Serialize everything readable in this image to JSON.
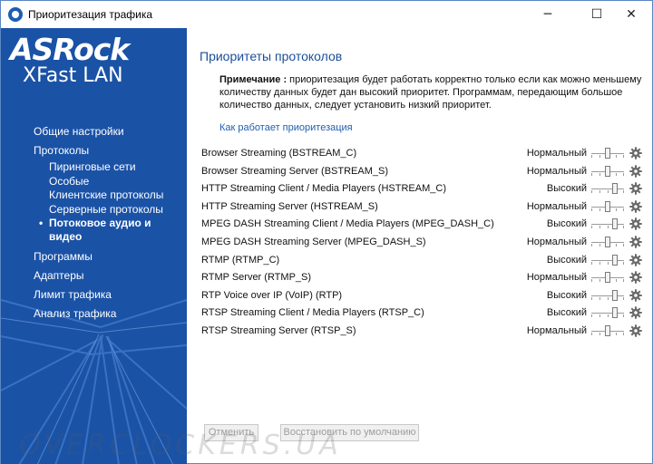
{
  "window": {
    "title": "Приоритезация трафика",
    "controls": {
      "minimize": "─",
      "maximize": "☐",
      "close": "✕"
    }
  },
  "sidebar": {
    "logo_brand": "ASRock",
    "logo_product": "XFast LAN",
    "nav": [
      {
        "label": "Общие настройки",
        "level": 0
      },
      {
        "label": "Протоколы",
        "level": 0
      },
      {
        "label": "Пиринговые сети",
        "level": 1
      },
      {
        "label": "Особые",
        "level": 1
      },
      {
        "label": "Клиентские протоколы",
        "level": 1
      },
      {
        "label": "Серверные протоколы",
        "level": 1
      },
      {
        "label": "Потоковое аудио и видео",
        "level": 1,
        "active": true
      },
      {
        "label": "Программы",
        "level": 0
      },
      {
        "label": "Адаптеры",
        "level": 0
      },
      {
        "label": "Лимит трафика",
        "level": 0
      },
      {
        "label": "Анализ трафика",
        "level": 0
      }
    ],
    "active_bullet": "•"
  },
  "main": {
    "title": "Приоритеты протоколов",
    "note_label": "Примечание :",
    "note_text": " приоритезация будет работать корректно только если как можно меньшему количеству данных будет дан высокий приоритет. Программам, передающим большое количество данных, следует установить низкий приоритет.",
    "help_link": "Как работает приоритезация",
    "protocols": [
      {
        "name": "Browser Streaming (BSTREAM_C)",
        "priority": "Нормальный",
        "level": 0.5
      },
      {
        "name": "Browser Streaming Server (BSTREAM_S)",
        "priority": "Нормальный",
        "level": 0.5
      },
      {
        "name": "HTTP Streaming Client / Media Players (HSTREAM_C)",
        "priority": "Высокий",
        "level": 0.75
      },
      {
        "name": "HTTP Streaming Server (HSTREAM_S)",
        "priority": "Нормальный",
        "level": 0.5
      },
      {
        "name": "MPEG DASH Streaming Client / Media Players (MPEG_DASH_C)",
        "priority": "Высокий",
        "level": 0.75
      },
      {
        "name": "MPEG DASH Streaming Server (MPEG_DASH_S)",
        "priority": "Нормальный",
        "level": 0.5
      },
      {
        "name": "RTMP (RTMP_C)",
        "priority": "Высокий",
        "level": 0.75
      },
      {
        "name": "RTMP Server (RTMP_S)",
        "priority": "Нормальный",
        "level": 0.5
      },
      {
        "name": "RTP Voice over IP (VoIP) (RTP)",
        "priority": "Высокий",
        "level": 0.75
      },
      {
        "name": "RTSP Streaming Client / Media Players (RTSP_C)",
        "priority": "Высокий",
        "level": 0.75
      },
      {
        "name": "RTSP Streaming Server (RTSP_S)",
        "priority": "Нормальный",
        "level": 0.5
      }
    ],
    "buttons": {
      "cancel": "Отменить",
      "restore": "Восстановить по умолчанию"
    }
  },
  "watermark": "OVERCLOCKERS.UA",
  "colors": {
    "sidebar": "#1a52a6",
    "title_blue": "#1a4f9a",
    "link": "#1f5fb0"
  }
}
